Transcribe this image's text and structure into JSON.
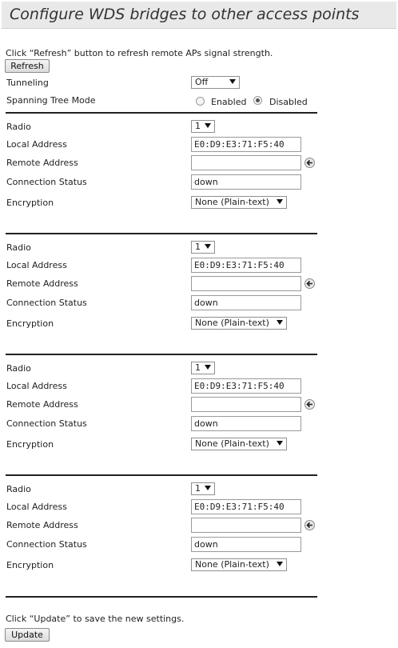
{
  "page": {
    "title": "Configure WDS bridges to other access points"
  },
  "refresh": {
    "hint": "Click “Refresh” button to refresh remote APs signal strength.",
    "button": "Refresh"
  },
  "tunneling": {
    "label": "Tunneling",
    "value": "Off"
  },
  "stp": {
    "label": "Spanning Tree Mode",
    "enabled": "Enabled",
    "disabled": "Disabled",
    "selected": "Disabled"
  },
  "labels": {
    "radio": "Radio",
    "local": "Local Address",
    "remote": "Remote Address",
    "status": "Connection Status",
    "encryption": "Encryption"
  },
  "bridges": [
    {
      "radio": "1",
      "local": "E0:D9:E3:71:F5:40",
      "remote": "",
      "status": "down",
      "encryption": "None (Plain-text)"
    },
    {
      "radio": "1",
      "local": "E0:D9:E3:71:F5:40",
      "remote": "",
      "status": "down",
      "encryption": "None (Plain-text)"
    },
    {
      "radio": "1",
      "local": "E0:D9:E3:71:F5:40",
      "remote": "",
      "status": "down",
      "encryption": "None (Plain-text)"
    },
    {
      "radio": "1",
      "local": "E0:D9:E3:71:F5:40",
      "remote": "",
      "status": "down",
      "encryption": "None (Plain-text)"
    }
  ],
  "update": {
    "hint": "Click “Update” to save the new settings.",
    "button": "Update"
  }
}
